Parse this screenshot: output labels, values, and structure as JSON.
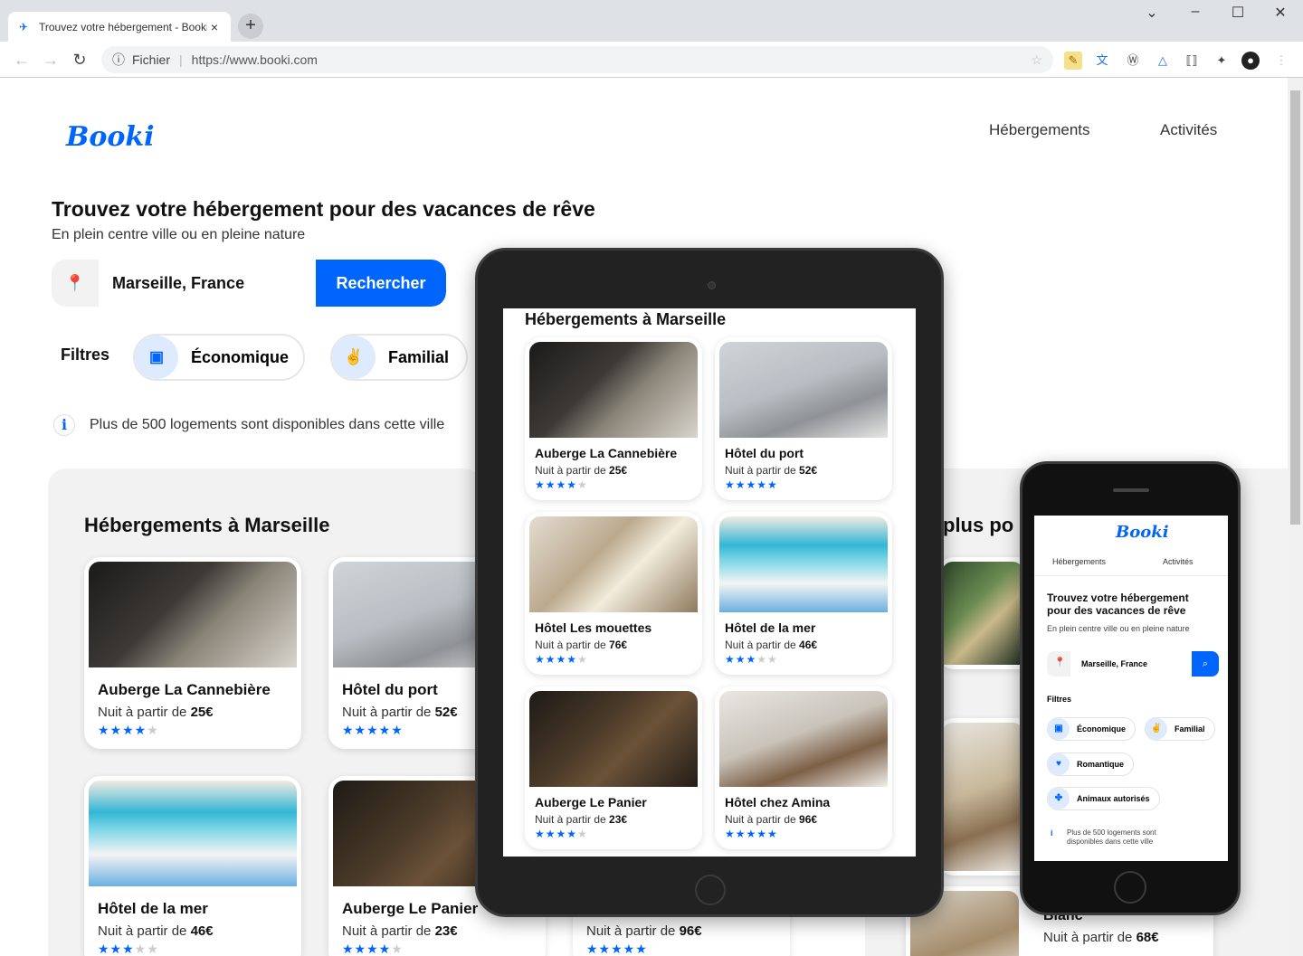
{
  "browser": {
    "tab_title": "Trouvez votre hébergement - Booki",
    "close_glyph": "×",
    "new_tab_glyph": "+",
    "scheme_label": "Fichier",
    "url": "https://www.booki.com"
  },
  "site": {
    "logo": "Booki",
    "nav": [
      "Hébergements",
      "Activités"
    ],
    "title": "Trouvez votre hébergement pour des vacances de rêve",
    "subtitle": "En plein centre ville ou en pleine nature",
    "search_value": "Marseille, France",
    "search_button": "Rechercher",
    "filters_label": "Filtres",
    "filters": [
      "Économique",
      "Familial"
    ],
    "info": "Plus de 500 logements sont disponibles dans cette ville",
    "section_title": "Hébergements à Marseille",
    "section2_partial_title": "plus po",
    "price_prefix": "Nuit à partir de"
  },
  "desktop_cards": [
    {
      "name": "Auberge La Cannebière",
      "price": "25€",
      "rating": 4
    },
    {
      "name": "Hôtel du port",
      "price": "52€",
      "rating": 5
    },
    {
      "name": "Hôtel de la mer",
      "price": "46€",
      "rating": 3
    },
    {
      "name": "Auberge Le Panier",
      "price": "23€",
      "rating": 4
    },
    {
      "name": "",
      "price": "96€",
      "rating": 5
    },
    {
      "name": "Blanc",
      "price": "68€",
      "rating": 0
    }
  ],
  "tablet": {
    "title": "Hébergements à Marseille",
    "cards": [
      {
        "name": "Auberge La Cannebière",
        "price": "25€",
        "rating": 4
      },
      {
        "name": "Hôtel du port",
        "price": "52€",
        "rating": 5
      },
      {
        "name": "Hôtel Les mouettes",
        "price": "76€",
        "rating": 4
      },
      {
        "name": "Hôtel de la mer",
        "price": "46€",
        "rating": 3
      },
      {
        "name": "Auberge Le Panier",
        "price": "23€",
        "rating": 4
      },
      {
        "name": "Hôtel chez Amina",
        "price": "96€",
        "rating": 5
      }
    ]
  },
  "phone": {
    "logo": "Booki",
    "nav": [
      "Hébergements",
      "Activités"
    ],
    "title": "Trouvez votre hébergement pour des vacances de rêve",
    "subtitle": "En plein centre ville ou en pleine nature",
    "search_value": "Marseille, France",
    "filters_label": "Filtres",
    "filters": [
      "Économique",
      "Familial",
      "Romantique",
      "Animaux autorisés"
    ],
    "info": "Plus de 500 logements sont disponibles dans cette ville"
  },
  "colors": {
    "brand": "#0065fc",
    "chip_bg": "#deebff",
    "section_bg": "#f2f2f2"
  }
}
